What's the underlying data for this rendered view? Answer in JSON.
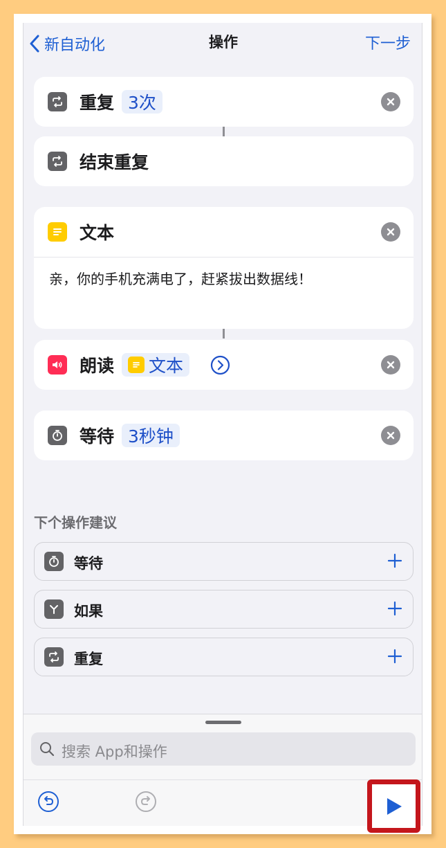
{
  "nav": {
    "back_label": "新自动化",
    "title": "操作",
    "next_label": "下一步"
  },
  "actions": {
    "repeat": {
      "title": "重复",
      "count": "3次"
    },
    "end_repeat": {
      "title": "结束重复"
    },
    "text": {
      "title": "文本",
      "content": "亲，你的手机充满电了，赶紧拔出数据线！"
    },
    "speak": {
      "title": "朗读",
      "param": "文本"
    },
    "wait": {
      "title": "等待",
      "param": "3秒钟"
    }
  },
  "suggestions": {
    "header": "下个操作建议",
    "items": [
      {
        "label": "等待",
        "icon": "timer-icon"
      },
      {
        "label": "如果",
        "icon": "branch-icon"
      },
      {
        "label": "重复",
        "icon": "repeat-icon"
      }
    ]
  },
  "search": {
    "placeholder": "搜索 App和操作"
  },
  "colors": {
    "accent": "#1E5FD3",
    "highlight": "#C4161C",
    "background": "#FFCC80"
  }
}
